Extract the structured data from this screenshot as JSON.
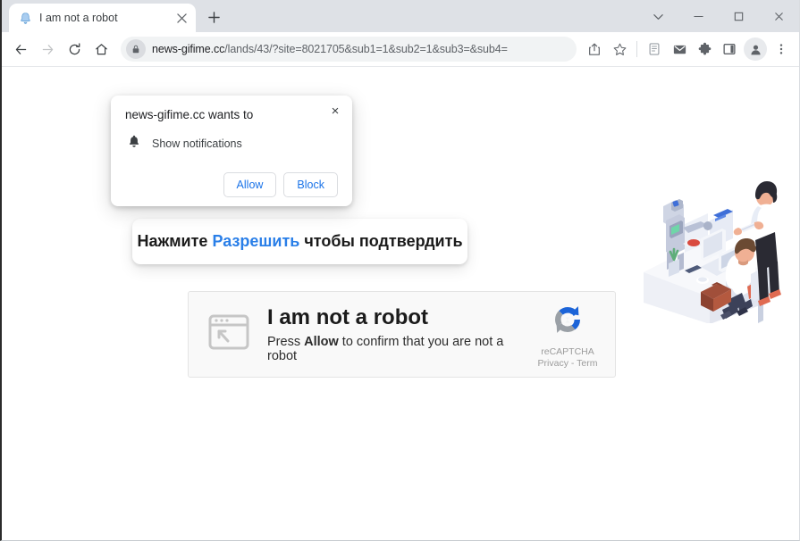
{
  "window": {
    "controls": {
      "tab_search": "tab-search",
      "minimize": "minimize",
      "maximize": "maximize",
      "close": "close"
    }
  },
  "tabstrip": {
    "tabs": [
      {
        "title": "I am not a robot",
        "favicon": "bell-icon",
        "active": true
      }
    ],
    "new_tab_label": "+"
  },
  "toolbar": {
    "back_label": "Back",
    "forward_label": "Forward",
    "reload_label": "Reload",
    "home_label": "Home",
    "omnibox": {
      "lock_icon": "lock-icon",
      "url_host": "news-gifime.cc",
      "url_path": "/lands/43/?site=8021705&sub1=1&sub2=1&sub3=&sub4=",
      "full_url": "news-gifime.cc/lands/43/?site=8021705&sub1=1&sub2=1&sub3=&sub4="
    },
    "icons": [
      {
        "name": "share-icon",
        "label": "Share"
      },
      {
        "name": "bookmark-star-icon",
        "label": "Bookmark this tab"
      },
      {
        "name": "reading-list-icon",
        "label": "Reading list"
      },
      {
        "name": "mail-icon",
        "label": "Mail"
      },
      {
        "name": "extensions-puzzle-icon",
        "label": "Extensions"
      },
      {
        "name": "side-panel-icon",
        "label": "Side panel"
      }
    ],
    "profile_label": "Profile",
    "menu_label": "Customize and control Google Chrome"
  },
  "permission_bubble": {
    "title": "news-gifime.cc wants to",
    "permission_icon": "bell-icon",
    "permission_label": "Show notifications",
    "allow_label": "Allow",
    "block_label": "Block",
    "close_label": "×"
  },
  "banner": {
    "prefix": "Нажмите ",
    "highlight": "Разрешить",
    "suffix": " чтобы подтвердить",
    "highlight_color": "#2a7fe8"
  },
  "captcha": {
    "window_icon": "browser-window-cursor-icon",
    "heading": "I am not a robot",
    "sub_prefix": "Press ",
    "sub_strong": "Allow",
    "sub_suffix": " to confirm that you are not a robot",
    "brand": "reCAPTCHA",
    "legal": "Privacy - Term",
    "logo_icon": "recaptcha-logo-icon",
    "logo_blue": "#1c64d8",
    "logo_gray": "#9aa0a6"
  },
  "illustration": {
    "name": "robot-office-workers-illustration",
    "alt": "Isometric illustration of a robot and two office workers at a desk"
  }
}
